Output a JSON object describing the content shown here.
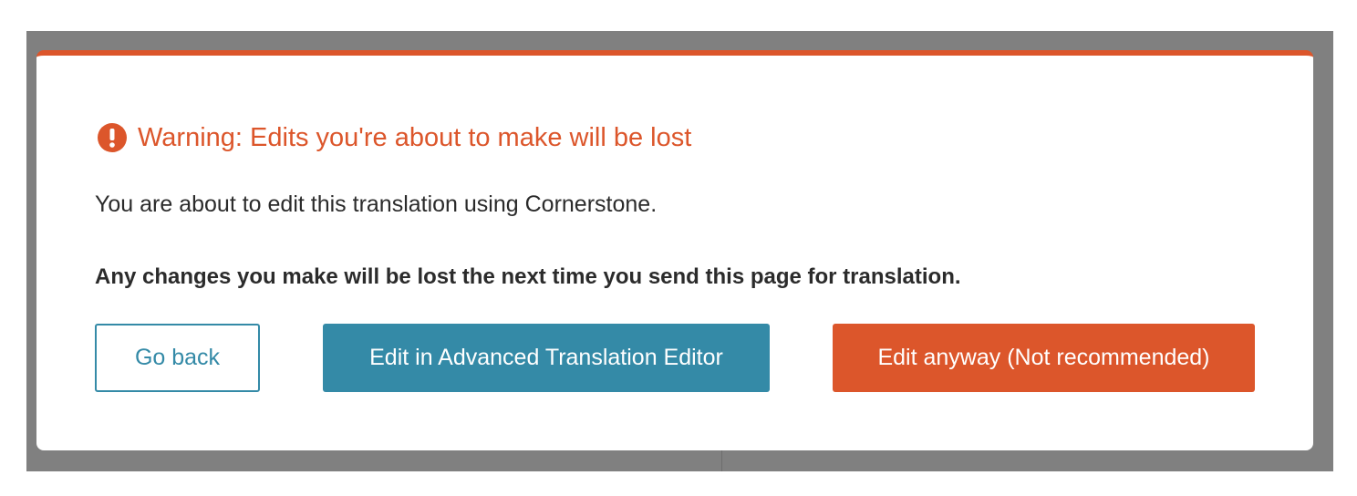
{
  "dialog": {
    "title": "Warning: Edits you're about to make will be lost",
    "icon": "exclamation-circle-icon",
    "message": "You are about to edit this translation using Cornerstone.",
    "warning_bold": "Any changes you make will be lost the next time you send this page for translation.",
    "buttons": {
      "go_back": "Go back",
      "advanced_editor": "Edit in Advanced Translation Editor",
      "edit_anyway": "Edit anyway (Not recommended)"
    }
  },
  "colors": {
    "warning": "#dc562b",
    "primary": "#348aa7",
    "overlay": "#808080",
    "text": "#2b2b2b"
  }
}
